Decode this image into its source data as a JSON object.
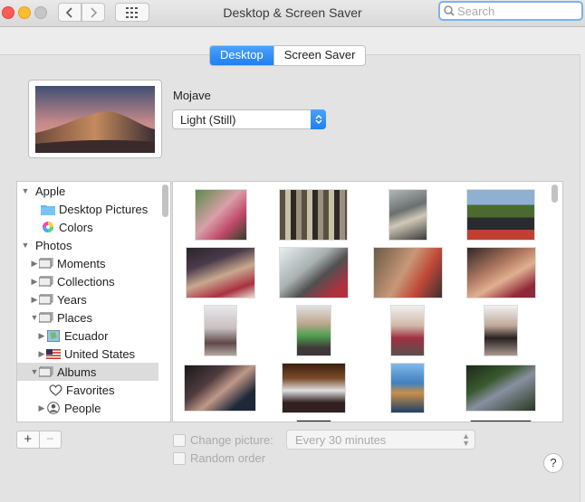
{
  "window": {
    "title": "Desktop & Screen Saver"
  },
  "search": {
    "placeholder": "Search"
  },
  "tabs": [
    {
      "label": "Desktop",
      "active": true
    },
    {
      "label": "Screen Saver",
      "active": false
    }
  ],
  "wallpaper": {
    "name": "Mojave",
    "mode": "Light (Still)"
  },
  "sidebar": {
    "items": [
      {
        "label": "Apple",
        "icon": "disclosure-open",
        "level": 0
      },
      {
        "label": "Desktop Pictures",
        "icon": "folder-icon",
        "level": 1
      },
      {
        "label": "Colors",
        "icon": "color-wheel-icon",
        "level": 1
      },
      {
        "label": "Photos",
        "icon": "disclosure-open",
        "level": 0
      },
      {
        "label": "Moments",
        "icon": "photo-stack-icon",
        "level": 1
      },
      {
        "label": "Collections",
        "icon": "photo-stack-icon",
        "level": 1
      },
      {
        "label": "Years",
        "icon": "photo-stack-icon",
        "level": 1
      },
      {
        "label": "Places",
        "icon": "photo-stack-icon",
        "level": 1
      },
      {
        "label": "Ecuador",
        "icon": "map-icon",
        "level": 2
      },
      {
        "label": "United States",
        "icon": "us-flag-icon",
        "level": 2
      },
      {
        "label": "Albums",
        "icon": "photo-stack-icon",
        "level": 1,
        "selected": true
      },
      {
        "label": "Favorites",
        "icon": "heart-icon",
        "level": 2
      },
      {
        "label": "People",
        "icon": "person-icon",
        "level": 2
      }
    ]
  },
  "controls": {
    "add": "+",
    "remove": "−",
    "change_picture": "Change picture:",
    "interval": "Every 30 minutes",
    "random_order": "Random order",
    "help": "?"
  },
  "colors": {
    "accent": "#1f7ff3"
  }
}
